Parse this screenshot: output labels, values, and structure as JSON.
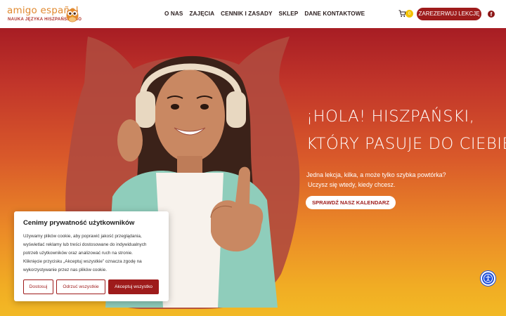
{
  "logo": {
    "name": "amigo español",
    "tagline": "NAUKA JĘZYKA HISZPAŃSKIEGO",
    "icon": "owl-icon"
  },
  "nav": {
    "items": [
      "O NAS",
      "ZAJĘCIA",
      "CENNIK I ZASADY",
      "SKLEP",
      "DANE KONTAKTOWE"
    ]
  },
  "cart": {
    "icon": "cart-icon",
    "count": "0"
  },
  "header": {
    "reserve_label": "ZAREZERWUJ LEKCJĘ",
    "social_icon": "facebook-icon"
  },
  "hero": {
    "title_line1": "¡HOLA! HISZPAŃSKI,",
    "title_line2": "KTÓRY PASUJE DO CIEBIE",
    "subtitle_line1": "Jedna lekcja, kilka, a może tylko szybka powtórka?",
    "subtitle_line2": "Uczysz się wtedy, kiedy chcesz.",
    "cta_label": "SPRAWDŹ NASZ KALENDARZ"
  },
  "cookie": {
    "title": "Cenimy prywatność użytkowników",
    "body_lines": [
      "Używamy plików cookie, aby poprawić jakość przeglądania,",
      "wyświetlać reklamy lub treści dostosowane do indywidualnych",
      "potrzeb użytkowników oraz analizować ruch na stronie.",
      "Kliknięcie przycisku „Akceptuj wszystkie” oznacza zgodę na",
      "wykorzystywanie przez nas plików cookie."
    ],
    "customize_label": "Dostosuj",
    "reject_label": "Odrzuć wszystkie",
    "accept_label": "Akceptuj wszystko"
  },
  "accessibility": {
    "icon": "accessibility-icon"
  },
  "colors": {
    "brand": "#9e1b1b",
    "logo_orange": "#e0892f",
    "gradient_top": "#a71d24",
    "gradient_bottom": "#f2b925",
    "accessibility_blue": "#1f4fd9"
  }
}
